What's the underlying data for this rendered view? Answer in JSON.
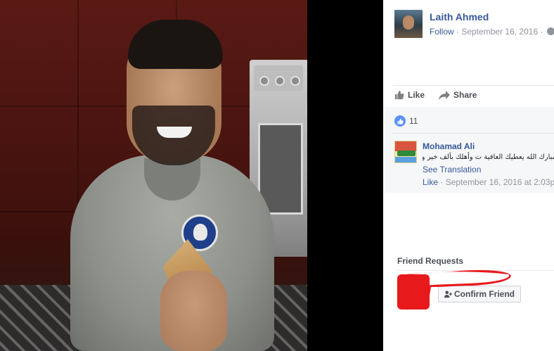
{
  "post": {
    "author_name": "Laith Ahmed",
    "follow_label": "Follow",
    "separator": "·",
    "date": "September 16, 2016",
    "date_separator": "·"
  },
  "actions": {
    "like_label": "Like",
    "share_label": "Share"
  },
  "reactions": {
    "count": "11"
  },
  "comment": {
    "author": "Mohamad Ali",
    "text": "مبارك الله يعطيك العافية ت وأهلك بألف خير وصحة وهذا الكبة عقليك",
    "see_translation": "See Translation",
    "like_label": "Like",
    "separator": "·",
    "timestamp": "September 16, 2016 at 2:03pm"
  },
  "sidebar": {
    "friend_requests_title": "Friend Requests",
    "confirm_friend_label": "Confirm Friend"
  },
  "colors": {
    "link_blue": "#365899",
    "like_blue": "#5890ff",
    "redaction_red": "#e8191b"
  },
  "icons": {
    "like": "thumbs-up-icon",
    "share": "share-arrow-icon",
    "privacy": "globe-icon",
    "add_friend": "add-friend-icon"
  }
}
